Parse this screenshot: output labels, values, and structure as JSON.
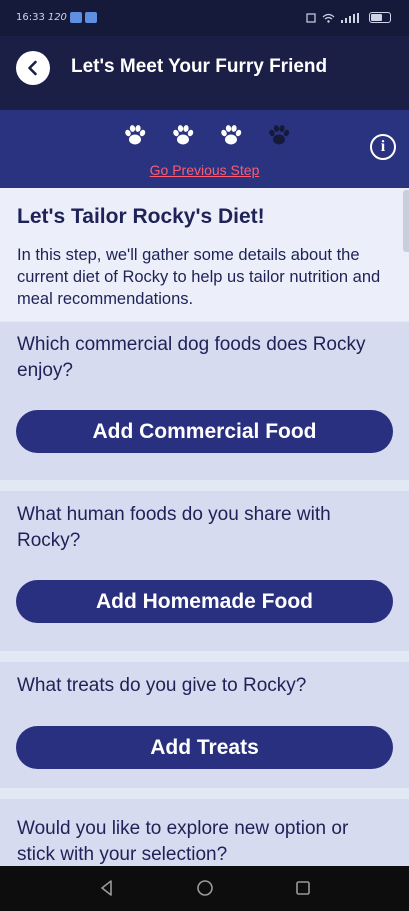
{
  "status_bar": {
    "time": "16:33",
    "speed": "120",
    "notification_icons": [
      "upload-icon",
      "message-icon"
    ],
    "right_icons": [
      "nfc-icon",
      "wifi-icon",
      "signal-icon",
      "battery-icon"
    ]
  },
  "header": {
    "back_icon": "chevron-left-icon",
    "title": "Let's Meet Your Furry Friend"
  },
  "progress": {
    "total_steps": 4,
    "completed_steps": 3,
    "step_icon": "paw-icon",
    "active_color": "#ffffff",
    "inactive_color": "#151a3a",
    "previous_link": "Go Previous Step",
    "info_icon": "info-icon"
  },
  "intro": {
    "title": "Let's Tailor Rocky's Diet!",
    "body": "In this step, we'll gather some details about the current diet of Rocky to help us tailor nutrition and meal recommendations."
  },
  "questions": [
    {
      "text": "Which commercial dog foods does Rocky enjoy?",
      "button": "Add Commercial Food"
    },
    {
      "text": "What human foods do you share with Rocky?",
      "button": "Add Homemade Food"
    },
    {
      "text": "What treats do you give to Rocky?",
      "button": "Add Treats"
    },
    {
      "text": "Would you like to explore new option or stick with your selection?"
    }
  ],
  "colors": {
    "header_bg": "#1b1e45",
    "progress_bg": "#2a3380",
    "button_bg": "#2a3080",
    "link": "#ff5b70",
    "text": "#1e2257"
  },
  "nav": {
    "back": "triangle-back-icon",
    "home": "circle-home-icon",
    "recents": "square-recents-icon"
  }
}
